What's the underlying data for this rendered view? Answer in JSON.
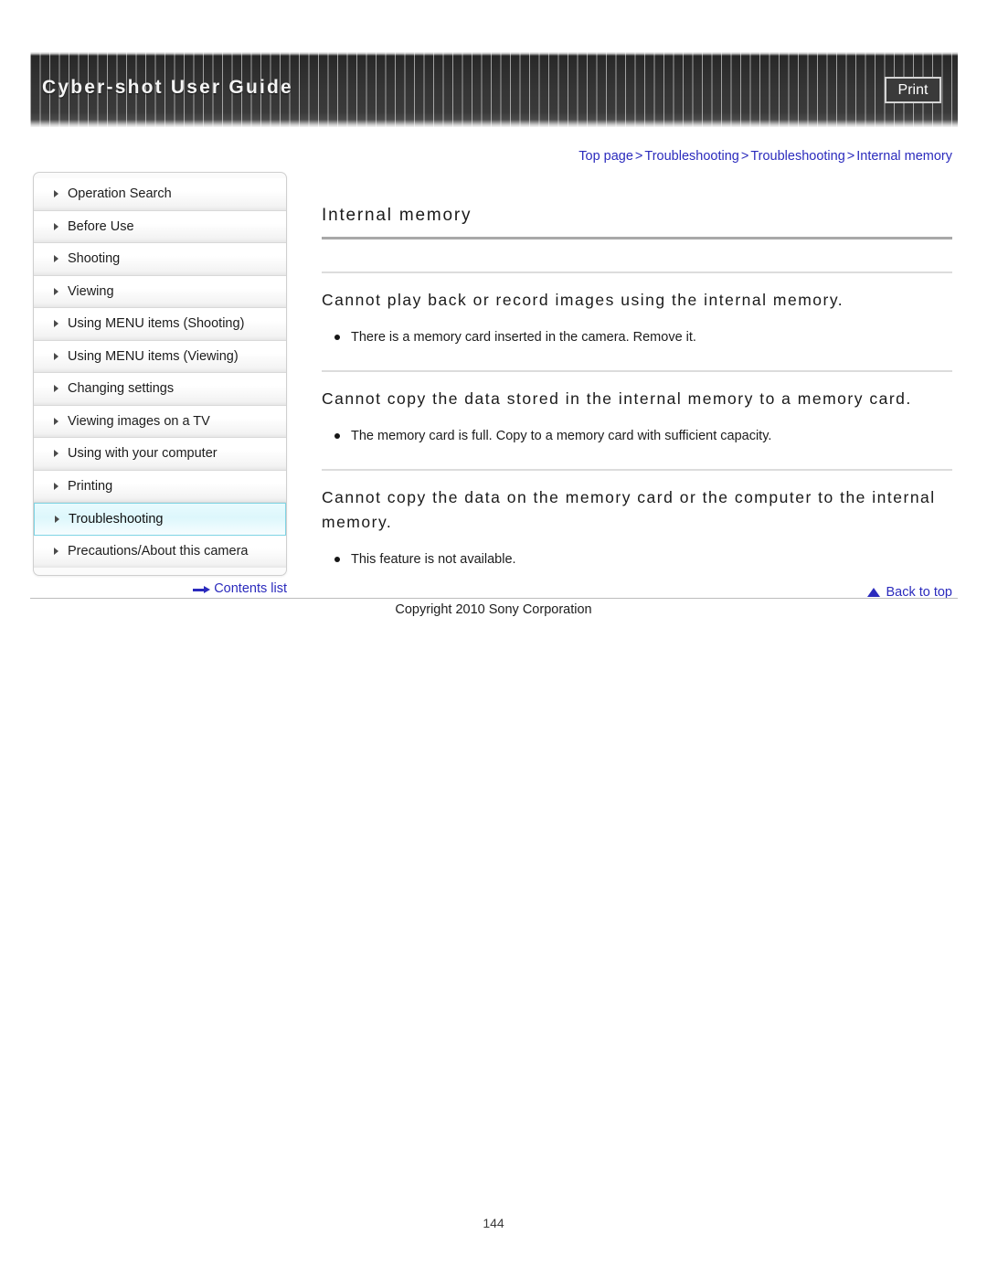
{
  "header": {
    "title": "Cyber-shot User Guide",
    "print_label": "Print"
  },
  "breadcrumb": {
    "items": [
      "Top page",
      "Troubleshooting",
      "Troubleshooting",
      "Internal memory"
    ],
    "separator": ">"
  },
  "sidebar": {
    "items": [
      {
        "label": "Operation Search",
        "active": false
      },
      {
        "label": "Before Use",
        "active": false
      },
      {
        "label": "Shooting",
        "active": false
      },
      {
        "label": "Viewing",
        "active": false
      },
      {
        "label": "Using MENU items (Shooting)",
        "active": false
      },
      {
        "label": "Using MENU items (Viewing)",
        "active": false
      },
      {
        "label": "Changing settings",
        "active": false
      },
      {
        "label": "Viewing images on a TV",
        "active": false
      },
      {
        "label": "Using with your computer",
        "active": false
      },
      {
        "label": "Printing",
        "active": false
      },
      {
        "label": "Troubleshooting",
        "active": true
      },
      {
        "label": "Precautions/About this camera",
        "active": false
      }
    ],
    "contents_list_label": "Contents list",
    "contents_list_icon": "arrow-right-icon",
    "active_highlight_color": "#ddf7fc",
    "active_border_color": "#7fd4e4"
  },
  "main": {
    "page_title": "Internal memory",
    "sections": [
      {
        "heading": "Cannot play back or record images using the internal memory.",
        "bullets": [
          "There is a memory card inserted in the camera. Remove it."
        ]
      },
      {
        "heading": "Cannot copy the data stored in the internal memory to a memory card.",
        "bullets": [
          "The memory card is full. Copy to a memory card with sufficient capacity."
        ]
      },
      {
        "heading": "Cannot copy the data on the memory card or the computer to the internal memory.",
        "bullets": [
          "This feature is not available."
        ]
      }
    ],
    "back_to_top_label": "Back to top",
    "back_to_top_icon": "triangle-up-icon"
  },
  "footer": {
    "copyright": "Copyright 2010 Sony Corporation",
    "page_number": "144"
  },
  "colors": {
    "link_blue": "#2b2bbd",
    "header_dark": "#353535",
    "rule_gray": "#a8a8a8"
  }
}
